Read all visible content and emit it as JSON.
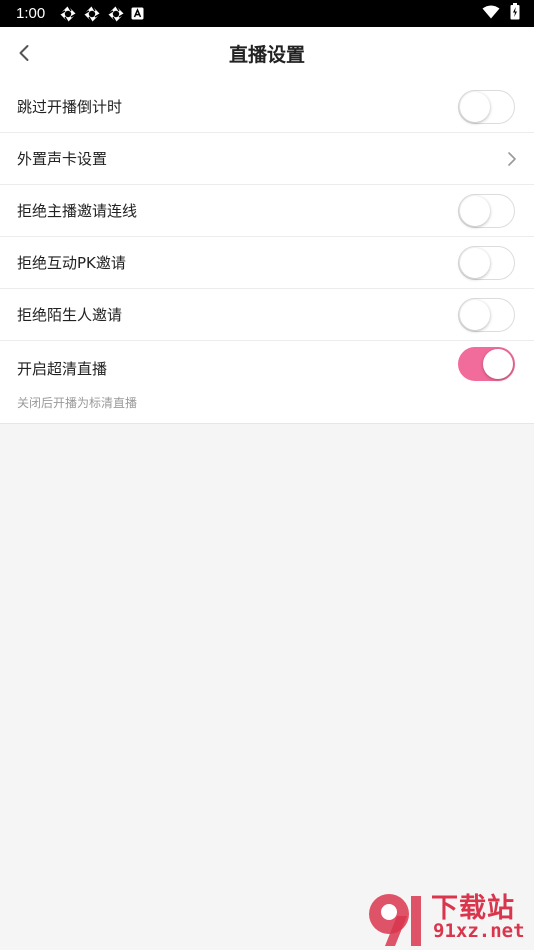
{
  "status_bar": {
    "time": "1:00",
    "notification_icons": [
      "pinwheel-icon",
      "pinwheel-icon",
      "pinwheel-icon",
      "a-box-icon"
    ],
    "right_icons": [
      "wifi-icon",
      "battery-icon"
    ]
  },
  "header": {
    "title": "直播设置",
    "back_icon": "chevron-left-icon"
  },
  "settings": {
    "items": [
      {
        "label": "跳过开播倒计时",
        "control": "toggle",
        "on": false
      },
      {
        "label": "外置声卡设置",
        "control": "chevron"
      },
      {
        "label": "拒绝主播邀请连线",
        "control": "toggle",
        "on": false
      },
      {
        "label": "拒绝互动PK邀请",
        "control": "toggle",
        "on": false
      },
      {
        "label": "拒绝陌生人邀请",
        "control": "toggle",
        "on": false
      },
      {
        "label": "开启超清直播",
        "control": "toggle",
        "on": true,
        "description": "关闭后开播为标清直播"
      }
    ]
  },
  "watermark": {
    "text_top": "下载站",
    "text_bottom": "91xz.net"
  },
  "colors": {
    "accent": "#f26c9b",
    "background": "#f5f5f5",
    "watermark": "#d9364e"
  }
}
